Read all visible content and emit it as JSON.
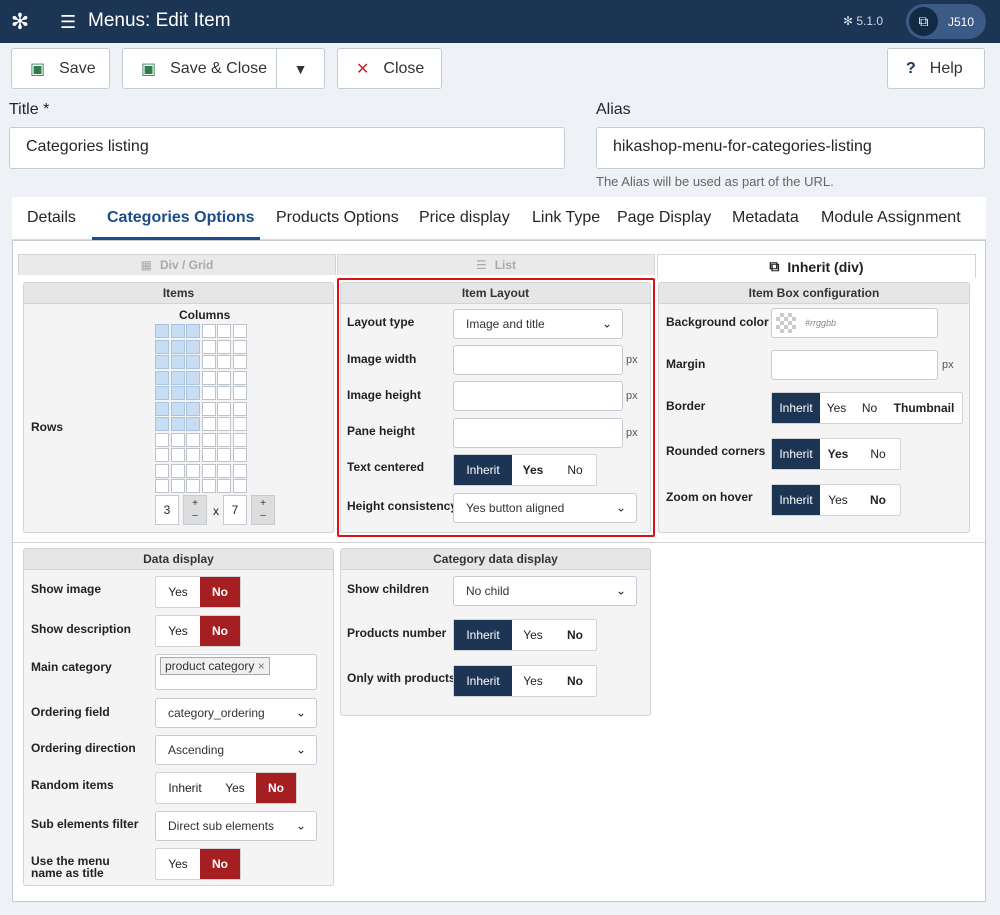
{
  "header": {
    "title": "Menus: Edit Item",
    "version": "5.1.0",
    "user": "J510",
    "logo_icon": "joomla-icon"
  },
  "toolbar": {
    "save": "Save",
    "save_close": "Save & Close",
    "close": "Close",
    "help": "Help"
  },
  "form": {
    "title_label": "Title *",
    "title_value": "Categories listing",
    "alias_label": "Alias",
    "alias_value": "hikashop-menu-for-categories-listing",
    "alias_hint": "The Alias will be used as part of the URL."
  },
  "tabs": [
    "Details",
    "Categories Options",
    "Products Options",
    "Price display",
    "Link Type",
    "Page Display",
    "Metadata",
    "Module Assignment"
  ],
  "layout_tabs": {
    "div_grid": "Div / Grid",
    "list": "List",
    "inherit": "Inherit (div)"
  },
  "items_box": {
    "header": "Items",
    "columns": "Columns",
    "rows": "Rows",
    "cols_value": "3",
    "x": "x",
    "rows_value": "7",
    "plus": "+",
    "minus": "–"
  },
  "item_layout": {
    "header": "Item Layout",
    "layout_type_label": "Layout type",
    "layout_type_value": "Image and title",
    "image_width_label": "Image width",
    "image_height_label": "Image height",
    "pane_height_label": "Pane height",
    "px": "px",
    "text_centered_label": "Text centered",
    "text_centered": [
      "Inherit",
      "Yes",
      "No"
    ],
    "height_consistency_label": "Height consistency",
    "height_consistency_value": "Yes button aligned"
  },
  "item_box": {
    "header": "Item Box configuration",
    "bg_color_label": "Background color",
    "bg_color_placeholder": "#rrggbb",
    "margin_label": "Margin",
    "px": "px",
    "border_label": "Border",
    "border": [
      "Inherit",
      "Yes",
      "No",
      "Thumbnail"
    ],
    "rounded_label": "Rounded corners",
    "rounded": [
      "Inherit",
      "Yes",
      "No"
    ],
    "zoom_label": "Zoom on hover",
    "zoom": [
      "Inherit",
      "Yes",
      "No"
    ]
  },
  "data_display": {
    "header": "Data display",
    "show_image_label": "Show image",
    "show_image": [
      "Yes",
      "No"
    ],
    "show_desc_label": "Show description",
    "show_desc": [
      "Yes",
      "No"
    ],
    "main_cat_label": "Main category",
    "main_cat_tag": "product category",
    "tag_remove": "×",
    "ordering_field_label": "Ordering field",
    "ordering_field_value": "category_ordering",
    "ordering_dir_label": "Ordering direction",
    "ordering_dir_value": "Ascending",
    "random_label": "Random items",
    "random": [
      "Inherit",
      "Yes",
      "No"
    ],
    "sub_filter_label": "Sub elements filter",
    "sub_filter_value": "Direct sub elements",
    "menu_name_label_1": "Use the menu",
    "menu_name_label_2": "name as title",
    "menu_name": [
      "Yes",
      "No"
    ]
  },
  "category_data": {
    "header": "Category data display",
    "show_children_label": "Show children",
    "show_children_value": "No child",
    "products_number_label": "Products number",
    "products_number": [
      "Inherit",
      "Yes",
      "No"
    ],
    "only_products_label": "Only with products",
    "only_products": [
      "Inherit",
      "Yes",
      "No"
    ]
  },
  "colors": {
    "header": "#1c3554",
    "dark_btn": "#1c3554",
    "red_btn": "#a51e22",
    "highlight": "#d11111"
  }
}
